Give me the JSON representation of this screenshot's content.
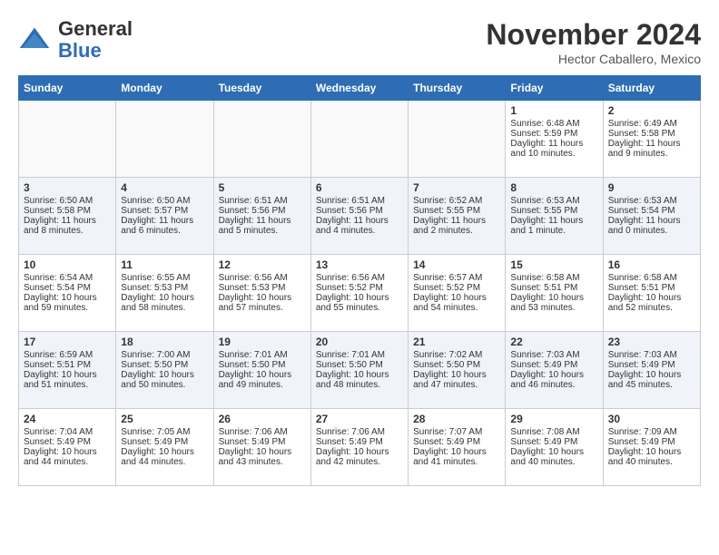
{
  "header": {
    "logo_general": "General",
    "logo_blue": "Blue",
    "title": "November 2024",
    "subtitle": "Hector Caballero, Mexico"
  },
  "columns": [
    "Sunday",
    "Monday",
    "Tuesday",
    "Wednesday",
    "Thursday",
    "Friday",
    "Saturday"
  ],
  "weeks": [
    [
      {
        "day": "",
        "info": ""
      },
      {
        "day": "",
        "info": ""
      },
      {
        "day": "",
        "info": ""
      },
      {
        "day": "",
        "info": ""
      },
      {
        "day": "",
        "info": ""
      },
      {
        "day": "1",
        "info": "Sunrise: 6:48 AM\nSunset: 5:59 PM\nDaylight: 11 hours and 10 minutes."
      },
      {
        "day": "2",
        "info": "Sunrise: 6:49 AM\nSunset: 5:58 PM\nDaylight: 11 hours and 9 minutes."
      }
    ],
    [
      {
        "day": "3",
        "info": "Sunrise: 6:50 AM\nSunset: 5:58 PM\nDaylight: 11 hours and 8 minutes."
      },
      {
        "day": "4",
        "info": "Sunrise: 6:50 AM\nSunset: 5:57 PM\nDaylight: 11 hours and 6 minutes."
      },
      {
        "day": "5",
        "info": "Sunrise: 6:51 AM\nSunset: 5:56 PM\nDaylight: 11 hours and 5 minutes."
      },
      {
        "day": "6",
        "info": "Sunrise: 6:51 AM\nSunset: 5:56 PM\nDaylight: 11 hours and 4 minutes."
      },
      {
        "day": "7",
        "info": "Sunrise: 6:52 AM\nSunset: 5:55 PM\nDaylight: 11 hours and 2 minutes."
      },
      {
        "day": "8",
        "info": "Sunrise: 6:53 AM\nSunset: 5:55 PM\nDaylight: 11 hours and 1 minute."
      },
      {
        "day": "9",
        "info": "Sunrise: 6:53 AM\nSunset: 5:54 PM\nDaylight: 11 hours and 0 minutes."
      }
    ],
    [
      {
        "day": "10",
        "info": "Sunrise: 6:54 AM\nSunset: 5:54 PM\nDaylight: 10 hours and 59 minutes."
      },
      {
        "day": "11",
        "info": "Sunrise: 6:55 AM\nSunset: 5:53 PM\nDaylight: 10 hours and 58 minutes."
      },
      {
        "day": "12",
        "info": "Sunrise: 6:56 AM\nSunset: 5:53 PM\nDaylight: 10 hours and 57 minutes."
      },
      {
        "day": "13",
        "info": "Sunrise: 6:56 AM\nSunset: 5:52 PM\nDaylight: 10 hours and 55 minutes."
      },
      {
        "day": "14",
        "info": "Sunrise: 6:57 AM\nSunset: 5:52 PM\nDaylight: 10 hours and 54 minutes."
      },
      {
        "day": "15",
        "info": "Sunrise: 6:58 AM\nSunset: 5:51 PM\nDaylight: 10 hours and 53 minutes."
      },
      {
        "day": "16",
        "info": "Sunrise: 6:58 AM\nSunset: 5:51 PM\nDaylight: 10 hours and 52 minutes."
      }
    ],
    [
      {
        "day": "17",
        "info": "Sunrise: 6:59 AM\nSunset: 5:51 PM\nDaylight: 10 hours and 51 minutes."
      },
      {
        "day": "18",
        "info": "Sunrise: 7:00 AM\nSunset: 5:50 PM\nDaylight: 10 hours and 50 minutes."
      },
      {
        "day": "19",
        "info": "Sunrise: 7:01 AM\nSunset: 5:50 PM\nDaylight: 10 hours and 49 minutes."
      },
      {
        "day": "20",
        "info": "Sunrise: 7:01 AM\nSunset: 5:50 PM\nDaylight: 10 hours and 48 minutes."
      },
      {
        "day": "21",
        "info": "Sunrise: 7:02 AM\nSunset: 5:50 PM\nDaylight: 10 hours and 47 minutes."
      },
      {
        "day": "22",
        "info": "Sunrise: 7:03 AM\nSunset: 5:49 PM\nDaylight: 10 hours and 46 minutes."
      },
      {
        "day": "23",
        "info": "Sunrise: 7:03 AM\nSunset: 5:49 PM\nDaylight: 10 hours and 45 minutes."
      }
    ],
    [
      {
        "day": "24",
        "info": "Sunrise: 7:04 AM\nSunset: 5:49 PM\nDaylight: 10 hours and 44 minutes."
      },
      {
        "day": "25",
        "info": "Sunrise: 7:05 AM\nSunset: 5:49 PM\nDaylight: 10 hours and 44 minutes."
      },
      {
        "day": "26",
        "info": "Sunrise: 7:06 AM\nSunset: 5:49 PM\nDaylight: 10 hours and 43 minutes."
      },
      {
        "day": "27",
        "info": "Sunrise: 7:06 AM\nSunset: 5:49 PM\nDaylight: 10 hours and 42 minutes."
      },
      {
        "day": "28",
        "info": "Sunrise: 7:07 AM\nSunset: 5:49 PM\nDaylight: 10 hours and 41 minutes."
      },
      {
        "day": "29",
        "info": "Sunrise: 7:08 AM\nSunset: 5:49 PM\nDaylight: 10 hours and 40 minutes."
      },
      {
        "day": "30",
        "info": "Sunrise: 7:09 AM\nSunset: 5:49 PM\nDaylight: 10 hours and 40 minutes."
      }
    ]
  ]
}
